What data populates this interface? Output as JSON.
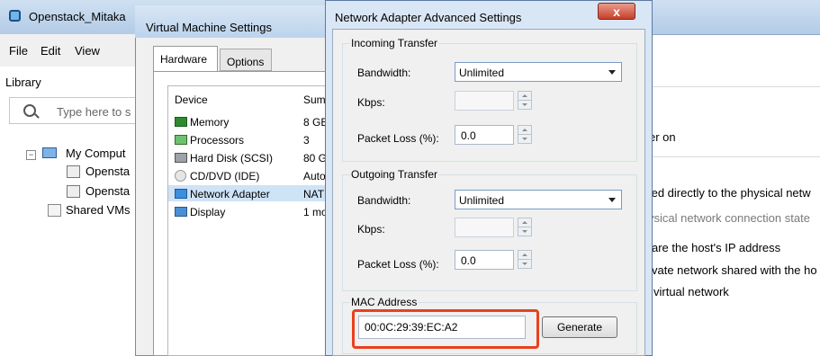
{
  "main_window": {
    "title": "Openstack_Mitaka",
    "menu": [
      "File",
      "Edit",
      "View"
    ],
    "library": {
      "title": "Library",
      "search_placeholder": "Type here to s",
      "tree": [
        {
          "label": "My Comput",
          "icon": "monitor-icon"
        },
        {
          "label": "Opensta",
          "icon": "vm-icon"
        },
        {
          "label": "Opensta",
          "icon": "vm-icon"
        },
        {
          "label": "Shared VMs",
          "icon": "shared-icon"
        }
      ]
    },
    "right_panel": {
      "line1": "er on",
      "line2": "ted directly to the physical netw",
      "line3": "ysical network connection state",
      "line4": "are the host's IP address",
      "line5": "vate network shared with the ho",
      "line6": "virtual network"
    }
  },
  "vm_settings": {
    "title": "Virtual Machine Settings",
    "tabs": [
      "Hardware",
      "Options"
    ],
    "columns": {
      "device": "Device",
      "summary": "Sum"
    },
    "devices": [
      {
        "name": "Memory",
        "summary": "8 GE",
        "icon": "memory-icon"
      },
      {
        "name": "Processors",
        "summary": "3",
        "icon": "processor-icon"
      },
      {
        "name": "Hard Disk (SCSI)",
        "summary": "80 G",
        "icon": "harddisk-icon"
      },
      {
        "name": "CD/DVD (IDE)",
        "summary": "Auto",
        "icon": "cd-icon"
      },
      {
        "name": "Network Adapter",
        "summary": "NAT",
        "icon": "network-adapter-icon",
        "selected": true
      },
      {
        "name": "Display",
        "summary": "1 mo",
        "icon": "display-icon"
      }
    ]
  },
  "advanced": {
    "title": "Network Adapter Advanced Settings",
    "close_label": "x",
    "incoming": {
      "legend": "Incoming Transfer",
      "bandwidth_label": "Bandwidth:",
      "bandwidth_value": "Unlimited",
      "kbps_label": "Kbps:",
      "kbps_value": "",
      "loss_label": "Packet Loss (%):",
      "loss_value": "0.0"
    },
    "outgoing": {
      "legend": "Outgoing Transfer",
      "bandwidth_label": "Bandwidth:",
      "bandwidth_value": "Unlimited",
      "kbps_label": "Kbps:",
      "kbps_value": "",
      "loss_label": "Packet Loss (%):",
      "loss_value": "0.0"
    },
    "mac": {
      "legend": "MAC Address",
      "value": "00:0C:29:39:EC:A2",
      "generate_label": "Generate"
    }
  },
  "colors": {
    "highlight": "#e8411e",
    "selected_row": "#cfe3f7"
  }
}
